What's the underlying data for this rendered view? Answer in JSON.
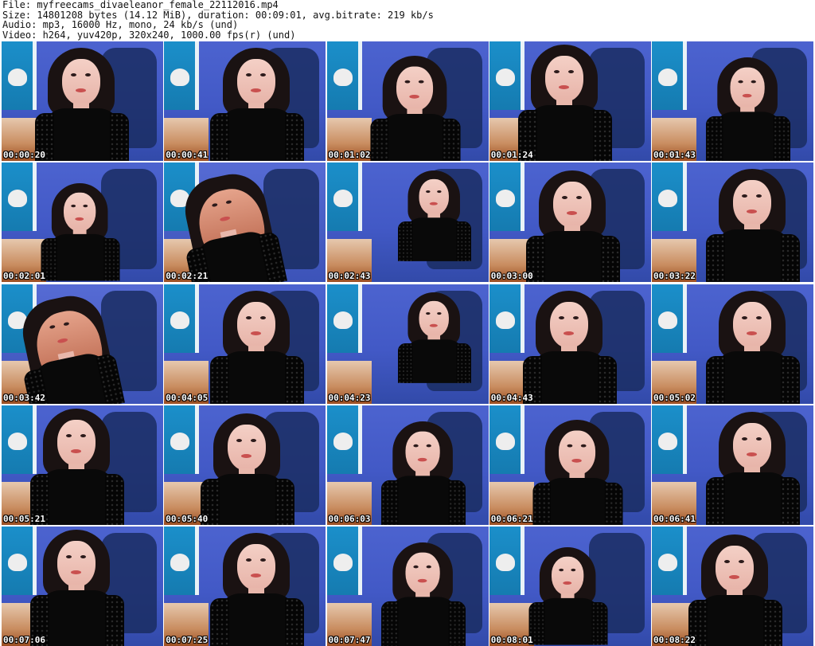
{
  "header": {
    "file_line": "File: myfreecams_divaeleanor_female_22112016.mp4",
    "size_line": "Size: 14801208 bytes (14.12 MiB), duration: 00:09:01, avg.bitrate: 219 kb/s",
    "audio_line": "Audio: mp3, 16000 Hz, mono, 24 kb/s (und)",
    "video_line": "Video: h264, yuv420p, 320x240, 1000.00 fps(r) (und)"
  },
  "thumbnails": [
    {
      "timestamp": "00:00:20"
    },
    {
      "timestamp": "00:00:41"
    },
    {
      "timestamp": "00:01:02"
    },
    {
      "timestamp": "00:01:24"
    },
    {
      "timestamp": "00:01:43"
    },
    {
      "timestamp": "00:02:01"
    },
    {
      "timestamp": "00:02:21"
    },
    {
      "timestamp": "00:02:43"
    },
    {
      "timestamp": "00:03:00"
    },
    {
      "timestamp": "00:03:22"
    },
    {
      "timestamp": "00:03:42"
    },
    {
      "timestamp": "00:04:05"
    },
    {
      "timestamp": "00:04:23"
    },
    {
      "timestamp": "00:04:43"
    },
    {
      "timestamp": "00:05:02"
    },
    {
      "timestamp": "00:05:21"
    },
    {
      "timestamp": "00:05:40"
    },
    {
      "timestamp": "00:06:03"
    },
    {
      "timestamp": "00:06:21"
    },
    {
      "timestamp": "00:06:41"
    },
    {
      "timestamp": "00:07:06"
    },
    {
      "timestamp": "00:07:25"
    },
    {
      "timestamp": "00:07:47"
    },
    {
      "timestamp": "00:08:01"
    },
    {
      "timestamp": "00:08:22"
    }
  ]
}
